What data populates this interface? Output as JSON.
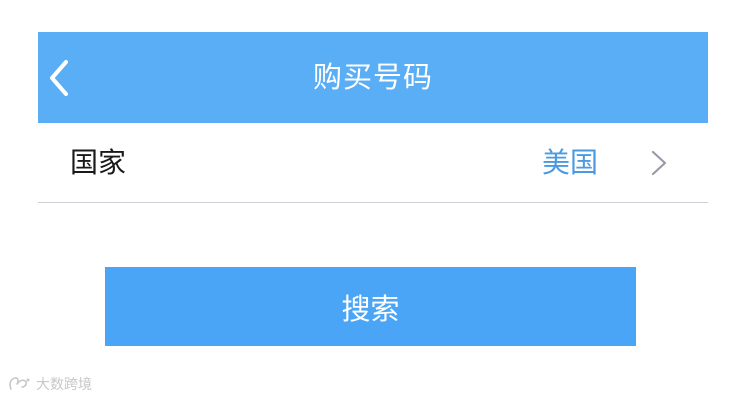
{
  "header": {
    "title": "购买号码",
    "back_icon": "chevron-left-icon"
  },
  "country_row": {
    "label": "国家",
    "value": "美国",
    "chevron_icon": "chevron-right-icon"
  },
  "search": {
    "label": "搜索"
  },
  "watermark": {
    "text": "大数跨境",
    "logo_icon": "brand-logo-icon"
  },
  "colors": {
    "navbar_bg": "#5aaef6",
    "button_bg": "#4ba5f7",
    "value_text": "#4a9ae0",
    "label_text": "#1a1a1a",
    "divider": "#cfcfd6",
    "chevron": "#9a9aa6"
  }
}
